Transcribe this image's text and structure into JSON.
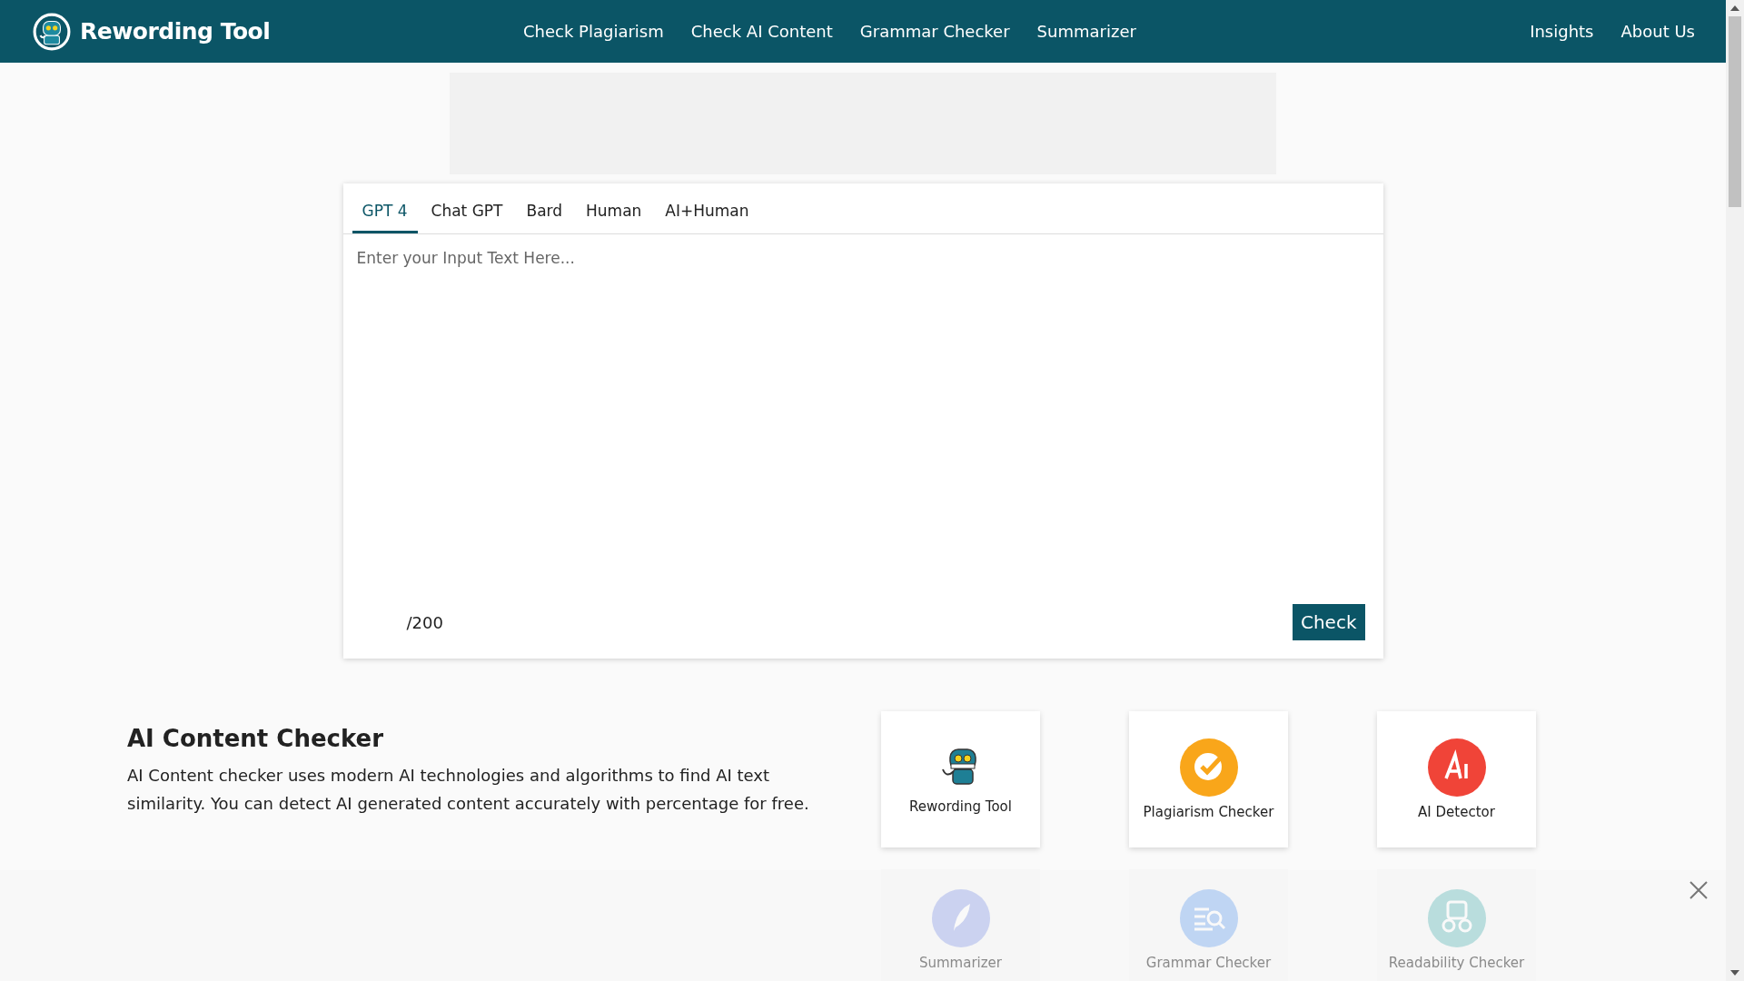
{
  "header": {
    "brand": "Rewording Tool",
    "nav": [
      {
        "label": "Check Plagiarism"
      },
      {
        "label": "Check AI Content"
      },
      {
        "label": "Grammar Checker"
      },
      {
        "label": "Summarizer"
      }
    ],
    "nav_right": [
      {
        "label": "Insights"
      },
      {
        "label": "About Us"
      }
    ]
  },
  "checker": {
    "tabs": [
      {
        "label": "GPT 4",
        "selected": true
      },
      {
        "label": "Chat GPT",
        "selected": false
      },
      {
        "label": "Bard",
        "selected": false
      },
      {
        "label": "Human",
        "selected": false
      },
      {
        "label": "AI+Human",
        "selected": false
      }
    ],
    "input": {
      "placeholder": "Enter your Input Text Here..."
    },
    "counter": "/200",
    "button": "Check"
  },
  "section": {
    "title": "AI Content Checker",
    "text": "AI Content checker uses modern AI technologies and algorithms to find AI text similarity. You can detect AI generated content accurately with percentage for free."
  },
  "tools": [
    {
      "label": "Rewording Tool",
      "kind": "robot"
    },
    {
      "label": "Plagiarism Checker",
      "kind": "check"
    },
    {
      "label": "AI Detector",
      "kind": "ai"
    },
    {
      "label": "Summarizer",
      "kind": "feather",
      "dimmed": true
    },
    {
      "label": "Grammar Checker",
      "kind": "lines",
      "dimmed": true
    },
    {
      "label": "Readability Checker",
      "kind": "glasses",
      "dimmed": true
    }
  ]
}
